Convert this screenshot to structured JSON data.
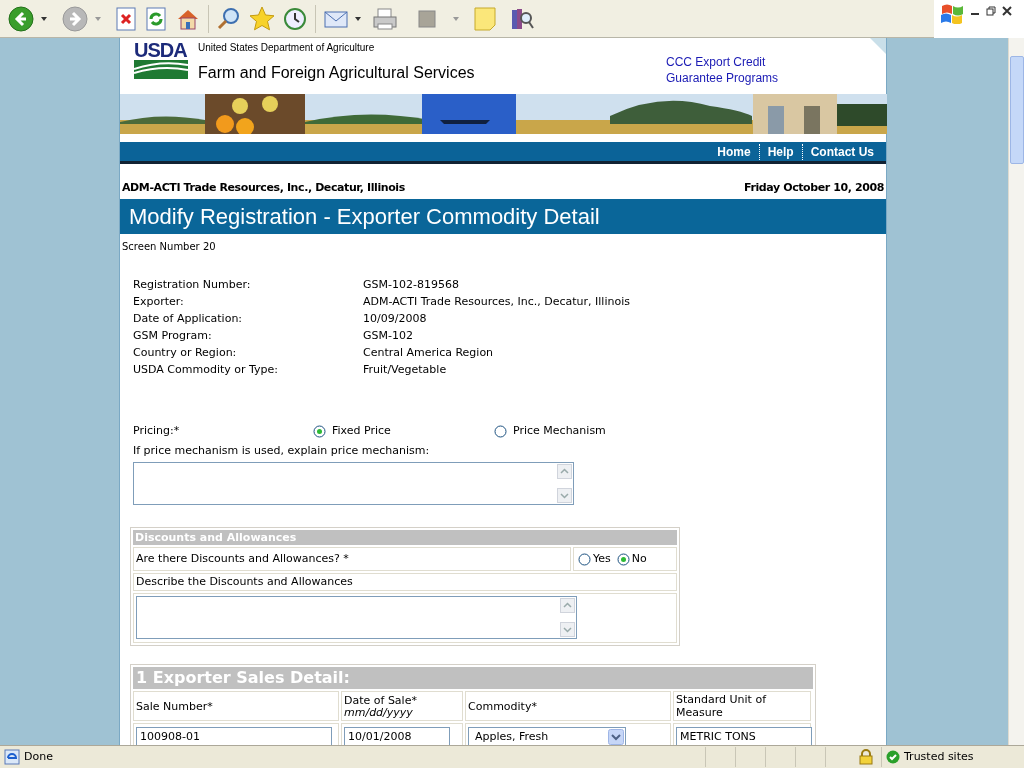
{
  "header": {
    "agency": "United States Department of Agriculture",
    "logo_text": "USDA",
    "site_title": "Farm and Foreign Agricultural Services",
    "program_link": [
      "CCC Export Credit",
      "Guarantee Programs"
    ]
  },
  "nav": [
    "Home",
    "Help",
    "Contact Us"
  ],
  "exporter_line": "ADM-ACTI Trade Resources, Inc., Decatur, Illinois",
  "date": "Friday October 10, 2008",
  "page_title": "Modify Registration - Exporter Commodity Detail",
  "screen_number": "Screen Number 20",
  "details": [
    {
      "label": "Registration Number:",
      "value": "GSM-102-819568"
    },
    {
      "label": "Exporter:",
      "value": "ADM-ACTI Trade Resources, Inc., Decatur, Illinois"
    },
    {
      "label": "Date of Application:",
      "value": "10/09/2008"
    },
    {
      "label": "GSM Program:",
      "value": "GSM-102"
    },
    {
      "label": "Country or Region:",
      "value": "Central America Region"
    },
    {
      "label": "USDA Commodity or Type:",
      "value": "Fruit/Vegetable"
    }
  ],
  "pricing": {
    "label": "Pricing:*",
    "options": [
      {
        "label": "Fixed Price",
        "selected": true
      },
      {
        "label": "Price Mechanism",
        "selected": false
      }
    ],
    "explain_label": "If price mechanism is used, explain price mechanism:"
  },
  "discounts": {
    "title": "Discounts and Allowances",
    "question": "Are there Discounts and Allowances? *",
    "options": [
      {
        "label": "Yes",
        "selected": false
      },
      {
        "label": "No",
        "selected": true
      }
    ],
    "describe_label": "Describe the Discounts and Allowances"
  },
  "sales_detail": {
    "title": "1 Exporter Sales Detail:",
    "columns": [
      {
        "label": "Sale Number*"
      },
      {
        "label": "Date of Sale*",
        "hint": "mm/dd/yyyy"
      },
      {
        "label": "Commodity*"
      },
      {
        "label": "Standard Unit of Measure"
      }
    ],
    "row": [
      {
        "kind": "text",
        "value": "100908-01"
      },
      {
        "kind": "text",
        "value": "10/01/2008"
      },
      {
        "kind": "select",
        "value": "Apples, Fresh"
      },
      {
        "kind": "text",
        "value": "METRIC TONS"
      }
    ]
  },
  "status_bar": {
    "text": "Done",
    "zone": "Trusted sites"
  }
}
